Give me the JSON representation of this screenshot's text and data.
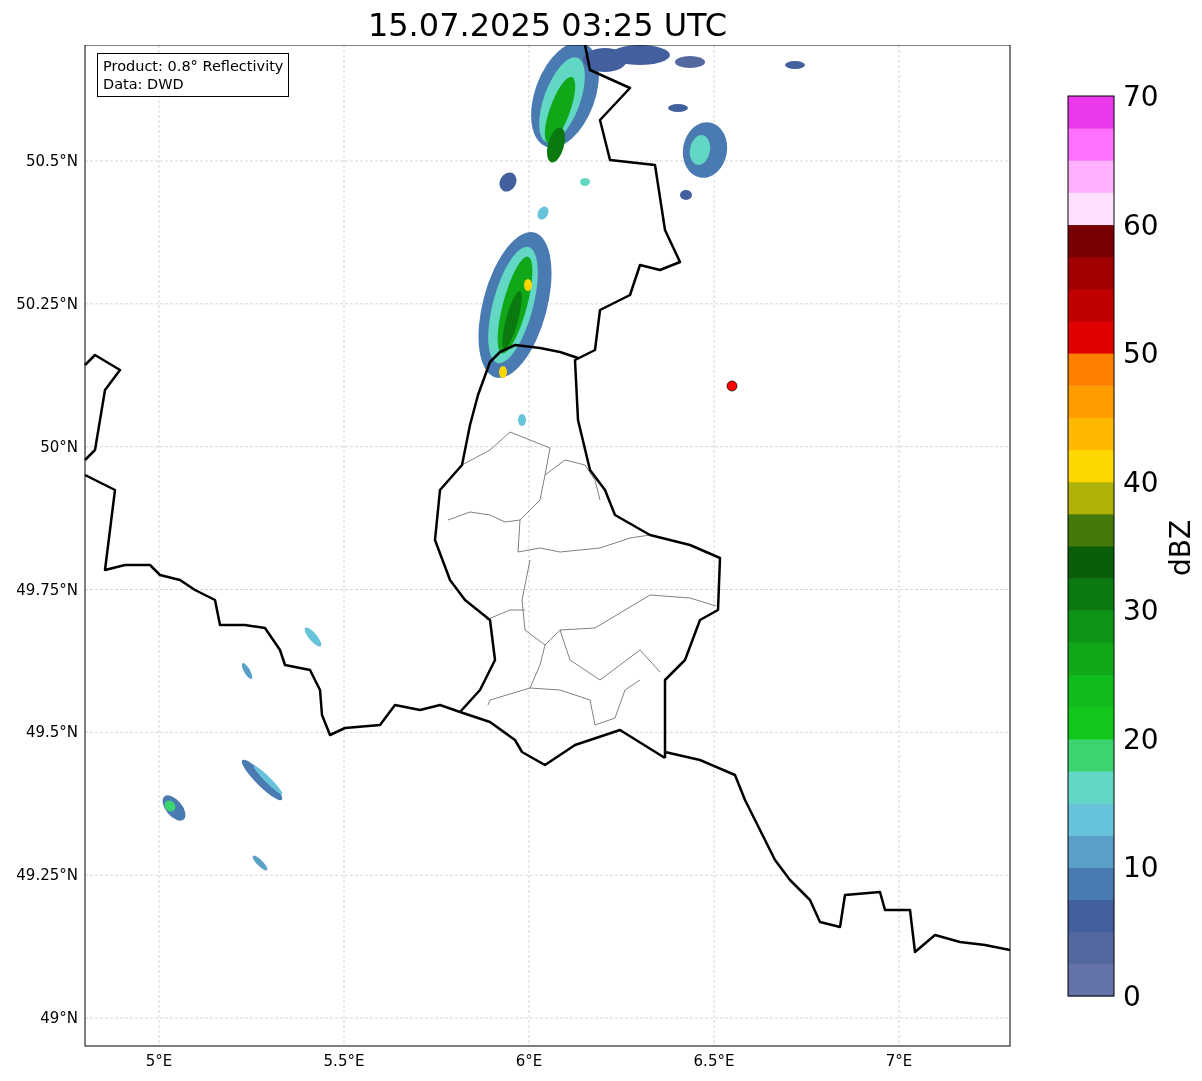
{
  "title": "15.07.2025 03:25 UTC",
  "info_box": [
    "Product: 0.8° Reflectivity",
    "Data: DWD"
  ],
  "map": {
    "lat_labels": [
      "50.5°N",
      "50.25°N",
      "50°N",
      "49.75°N",
      "49.5°N",
      "49.25°N",
      "49°N"
    ],
    "lon_labels": [
      "5°E",
      "5.5°E",
      "6°E",
      "6.5°E",
      "7°E"
    ]
  },
  "colorbar": {
    "label": "dBZ",
    "ticks": [
      "70",
      "60",
      "50",
      "40",
      "30",
      "20",
      "10",
      "0"
    ],
    "bands": [
      {
        "color": "#6473a8"
      },
      {
        "color": "#5468a0"
      },
      {
        "color": "#43609e"
      },
      {
        "color": "#4a7ab2"
      },
      {
        "color": "#5a9fc8"
      },
      {
        "color": "#66c3da"
      },
      {
        "color": "#62d8c4"
      },
      {
        "color": "#3dd470"
      },
      {
        "color": "#12c81a"
      },
      {
        "color": "#10bb1c"
      },
      {
        "color": "#10a818"
      },
      {
        "color": "#0d9517"
      },
      {
        "color": "#0a7a10"
      },
      {
        "color": "#085e0b"
      },
      {
        "color": "#457a0b"
      },
      {
        "color": "#b0b20a"
      },
      {
        "color": "#ffd700"
      },
      {
        "color": "#ffb800"
      },
      {
        "color": "#ff9c00"
      },
      {
        "color": "#ff8000"
      },
      {
        "color": "#e00000"
      },
      {
        "color": "#c00000"
      },
      {
        "color": "#a00000"
      },
      {
        "color": "#780000"
      },
      {
        "color": "#ffe0ff"
      },
      {
        "color": "#ffb0ff"
      },
      {
        "color": "#ff70ff"
      },
      {
        "color": "#ec38ec"
      }
    ]
  }
}
